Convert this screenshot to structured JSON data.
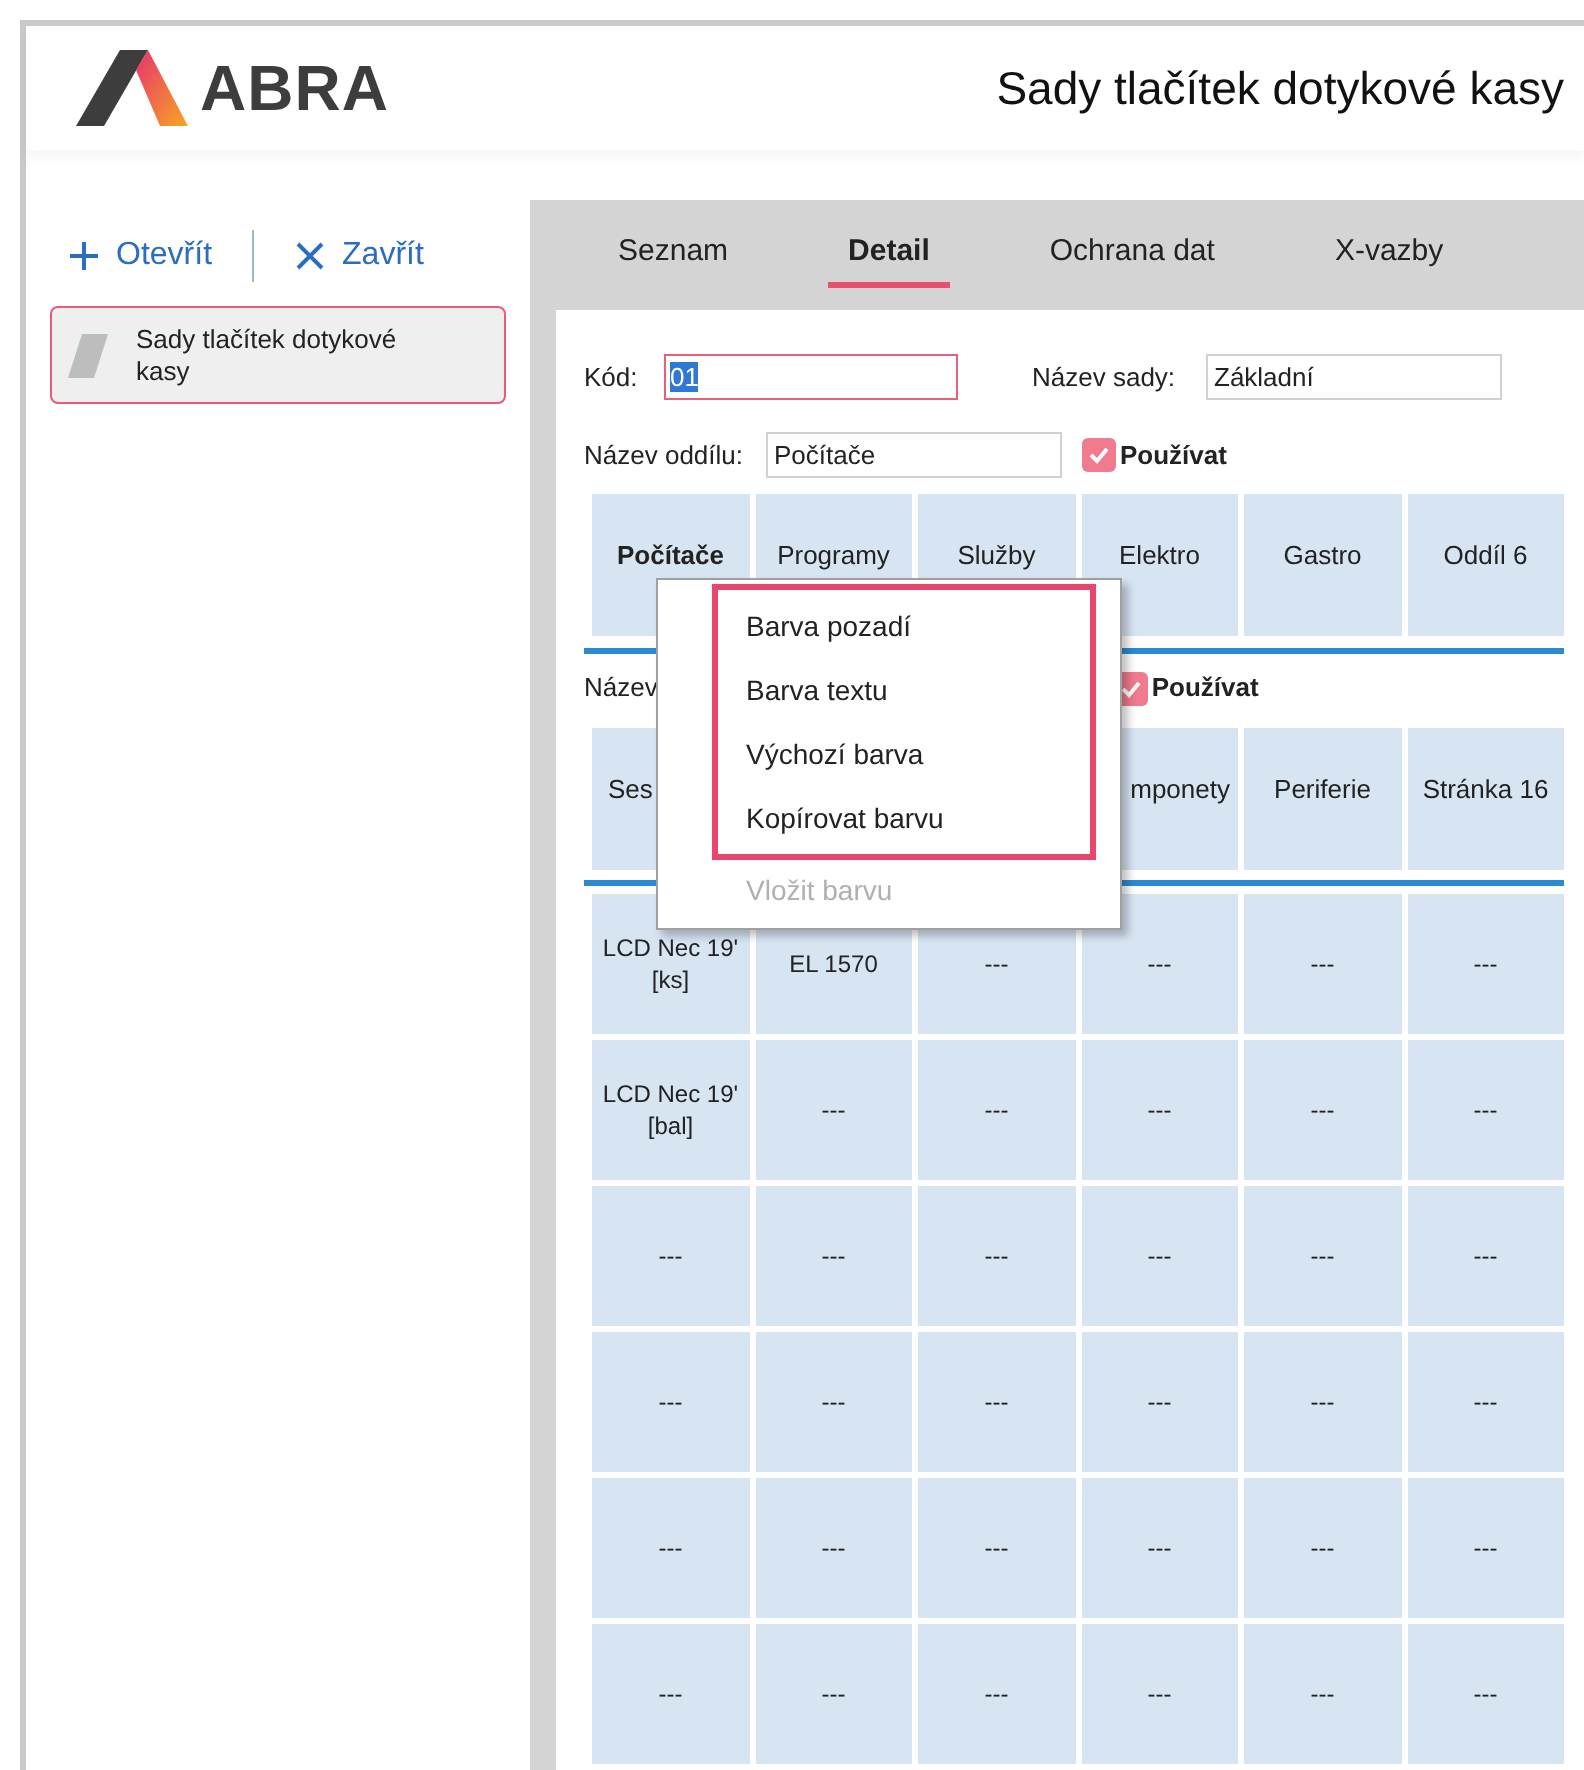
{
  "header": {
    "logo_text": "ABRA",
    "title": "Sady tlačítek dotykové kasy"
  },
  "sidebar": {
    "actions": [
      {
        "kind": "open",
        "label": "Otevřít"
      },
      {
        "kind": "close",
        "label": "Zavřít"
      }
    ],
    "items": [
      {
        "label": "Sady tlačítek dotykové kasy",
        "selected": true
      }
    ]
  },
  "tabs": [
    {
      "label": "Seznam",
      "selected": false
    },
    {
      "label": "Detail",
      "selected": true
    },
    {
      "label": "Ochrana dat",
      "selected": false
    },
    {
      "label": "X-vazby",
      "selected": false
    }
  ],
  "form": {
    "code_label": "Kód:",
    "code_value": "01",
    "set_name_label": "Název sady:",
    "set_name_value": "Základní"
  },
  "sections": [
    {
      "name_label": "Název oddílu:",
      "name_value": "Počítače",
      "use_label": "Používat",
      "use_checked": true,
      "groups": [
        {
          "label": "Počítače",
          "selected": true
        },
        {
          "label": "Programy",
          "selected": false
        },
        {
          "label": "Služby",
          "selected": false
        },
        {
          "label": "Elektro",
          "selected": false
        },
        {
          "label": "Gastro",
          "selected": false
        },
        {
          "label": "Oddíl 6",
          "selected": false
        }
      ]
    },
    {
      "name_label": "Název",
      "use_label": "Používat",
      "use_checked": true,
      "groups": [
        {
          "kind": "button",
          "label": "Ses",
          "selected": false
        },
        {
          "kind": "hidden"
        },
        {
          "kind": "hidden"
        },
        {
          "kind": "button",
          "label": "mponety",
          "selected": false
        },
        {
          "label": "Periferie",
          "selected": false
        },
        {
          "label": "Stránka 16",
          "selected": false
        }
      ]
    }
  ],
  "buttons": [
    [
      "LCD Nec 19' [ks]",
      "EL 1570",
      "---",
      "---",
      "---",
      "---"
    ],
    [
      "LCD Nec 19' [bal]",
      "---",
      "---",
      "---",
      "---",
      "---"
    ],
    [
      "---",
      "---",
      "---",
      "---",
      "---",
      "---"
    ],
    [
      "---",
      "---",
      "---",
      "---",
      "---",
      "---"
    ],
    [
      "---",
      "---",
      "---",
      "---",
      "---",
      "---"
    ],
    [
      "---",
      "---",
      "---",
      "---",
      "---",
      "---"
    ]
  ],
  "context_menu": [
    {
      "label": "Barva pozadí",
      "disabled": false,
      "highlighted": true
    },
    {
      "label": "Barva textu",
      "disabled": false,
      "highlighted": true
    },
    {
      "label": "Výchozí barva",
      "disabled": false,
      "highlighted": true
    },
    {
      "label": "Kopírovat barvu",
      "disabled": false,
      "highlighted": true
    },
    {
      "label": "Vložit barvu",
      "disabled": true,
      "highlighted": false
    }
  ]
}
